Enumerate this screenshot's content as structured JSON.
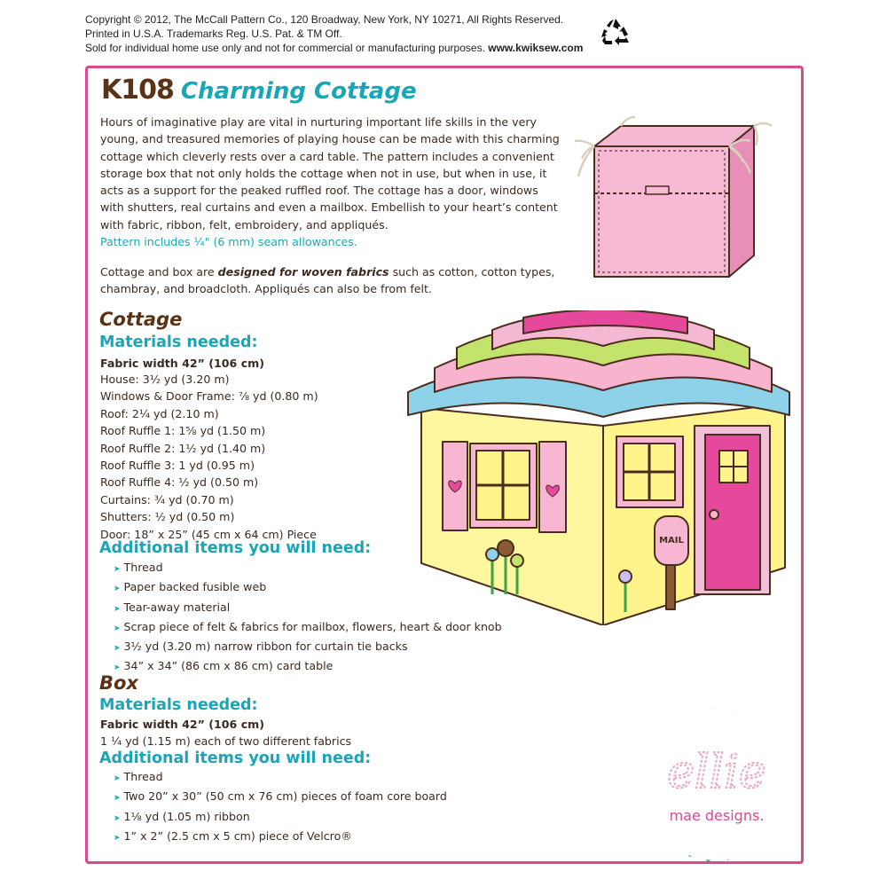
{
  "header": {
    "copyright_line1": "Copyright © 2012, The McCall Pattern Co., 120 Broadway, New York, NY 10271, All Rights Reserved.",
    "copyright_line2": "Printed in U.S.A. Trademarks Reg. U.S. Pat. & TM Off.",
    "copyright_line3": "Sold for individual home use only and not for commercial or manufacturing purposes.",
    "website": "www.kwiksew.com",
    "recycle_icon": "recycle-icon"
  },
  "title": {
    "code": "K108",
    "name": "Charming Cottage"
  },
  "intro": {
    "lines": [
      "Hours of imaginative play are vital in nurturing important life skills in the very",
      "young, and treasured memories of playing house can be made with this charming",
      "cottage which cleverly rests over a card table. The pattern includes a convenient",
      "storage box that not only holds the cottage when not in use, but when in use, it",
      "acts as a support for the peaked ruffled roof. The cottage has a door, windows",
      "with shutters, real curtains and even a mailbox. Embellish to your heart’s content",
      "with fabric, ribbon, felt, embroidery, and appliqués."
    ],
    "seam_note": "Pattern includes ¼\" (6 mm) seam allowances."
  },
  "fabrics_note": {
    "line1_before": "Cottage and box are ",
    "line1_emph": "designed for woven fabrics",
    "line1_after": " such as cotton, cotton types,",
    "line2": "chambray, and broadcloth. Appliqués can also be from felt."
  },
  "cottage": {
    "heading": "Cottage",
    "materials_heading": "Materials needed:",
    "fabric_width": "Fabric width 42” (106 cm)",
    "materials": [
      "House: 3½ yd (3.20 m)",
      "Windows & Door Frame: ⅞ yd (0.80 m)",
      "Roof: 2¼ yd (2.10 m)",
      "Roof Ruffle 1: 1⅝ yd (1.50 m)",
      "Roof Ruffle 2: 1½ yd (1.40 m)",
      "Roof Ruffle 3: 1 yd (0.95 m)",
      "Roof Ruffle 4: ½ yd (0.50 m)",
      "Curtains: ¾ yd (0.70 m)",
      "Shutters: ½ yd (0.50 m)",
      "Door: 18” x 25” (45 cm x 64 cm) Piece"
    ],
    "additional_heading": "Additional items you will need:",
    "additional": [
      "Thread",
      "Paper backed fusible web",
      "Tear-away material",
      "Scrap piece of felt & fabrics for mailbox, flowers, heart & door knob",
      "3½ yd (3.20 m) narrow ribbon for curtain tie backs",
      "34” x 34” (86 cm x 86 cm) card table"
    ]
  },
  "box": {
    "heading": "Box",
    "materials_heading": "Materials needed:",
    "fabric_width": "Fabric width 42” (106 cm)",
    "materials": [
      "1 ¼ yd (1.15 m) each of two different fabrics"
    ],
    "additional_heading": "Additional items you will need:",
    "additional": [
      "Thread",
      "Two 20” x 30” (50 cm x 76 cm) pieces of foam core board",
      "1⅛ yd (1.05 m) ribbon",
      "1” x 2” (2.5 cm x 5 cm) piece of Velcro®"
    ]
  },
  "illustration": {
    "mailbox_text": "MAIL"
  },
  "logo": {
    "script": "ellie",
    "tagline": "mae designs."
  },
  "colors": {
    "frame": "#d9498f",
    "teal": "#1aa6b7",
    "brown": "#5a3316",
    "logo_green": "#3daa4a"
  }
}
